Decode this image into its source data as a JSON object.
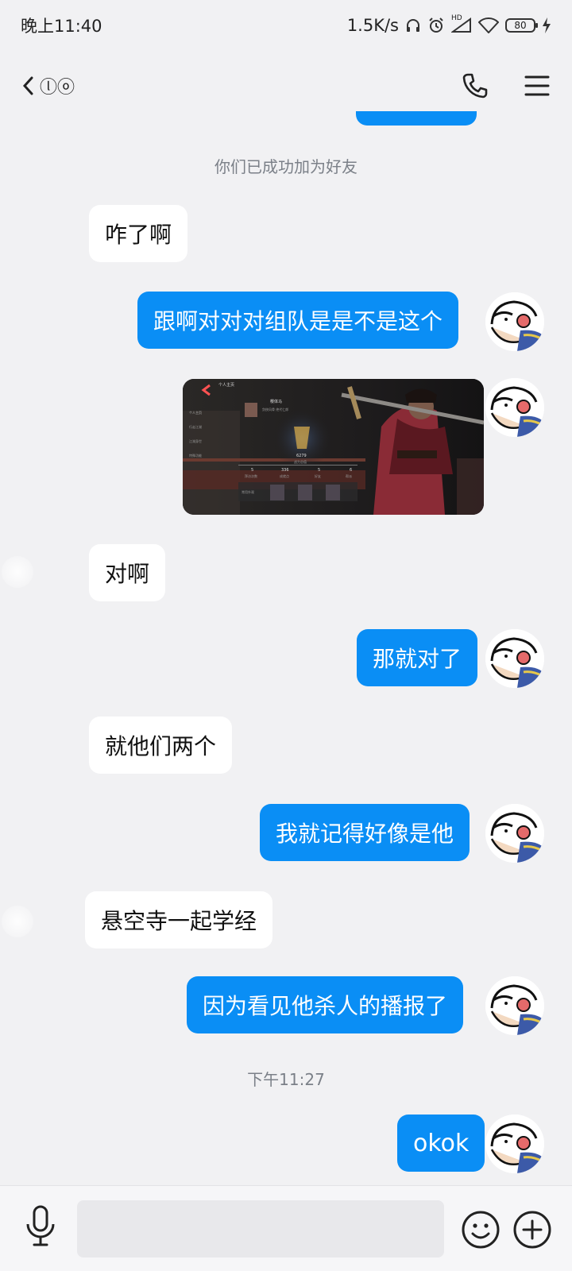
{
  "status_bar": {
    "time": "晚上11:40",
    "net_speed": "1.5K/s",
    "hd_label": "HD",
    "battery": "80"
  },
  "header": {
    "contact_name": "ⓛⓞ"
  },
  "icons": {
    "back": "back-arrow-icon",
    "phone": "phone-icon",
    "menu": "hamburger-menu-icon",
    "mic": "microphone-icon",
    "emoji": "emoji-icon",
    "plus": "plus-icon"
  },
  "colors": {
    "outgoing_bubble": "#0a8ef5",
    "incoming_bubble": "#ffffff",
    "background": "#f1f1f3"
  },
  "chat": {
    "system_friend_added": "你们已成功加为好友",
    "time_divider": "下午11:27",
    "messages": [
      {
        "direction": "in",
        "text": "咋了啊"
      },
      {
        "direction": "out",
        "text": "跟啊对对对组队是是不是这个"
      },
      {
        "direction": "out",
        "type": "image",
        "alt": "game screenshot"
      },
      {
        "direction": "in",
        "text": "对啊"
      },
      {
        "direction": "out",
        "text": "那就对了"
      },
      {
        "direction": "in",
        "text": "就他们两个"
      },
      {
        "direction": "out",
        "text": "我就记得好像是他"
      },
      {
        "direction": "in",
        "text": "悬空寺一起学经"
      },
      {
        "direction": "out",
        "text": "因为看见他杀人的播报了"
      },
      {
        "direction": "out",
        "text": "okok"
      }
    ]
  },
  "image_texts": {
    "title": "个人主页",
    "menu_1": "个人主页",
    "menu_2": "行走江湖",
    "menu_3": "江湖身世",
    "menu_4": "特殊功能",
    "player_name": "樱体马",
    "sub_line": "剑侠风骨 绝代仁郎",
    "score": "6279",
    "score_label": "战力总值",
    "stat_1_value": "5",
    "stat_1_label": "拜访次数",
    "stat_2_value": "336",
    "stat_2_label": "成就点",
    "stat_3_value": "5",
    "stat_3_label": "好友",
    "stat_4_value": "6",
    "stat_4_label": "帮派",
    "bottom_label": "常用外观"
  },
  "input": {
    "value": "",
    "placeholder": ""
  }
}
